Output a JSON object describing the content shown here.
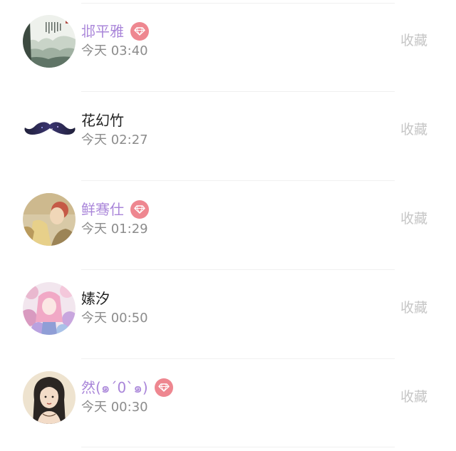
{
  "records": [
    {
      "name": "邶平雅",
      "vip": true,
      "time": "今天 03:40",
      "action": "收藏",
      "avatar_icon": "landscape-painting-avatar-icon"
    },
    {
      "name": "花幻竹",
      "vip": false,
      "time": "今天 02:27",
      "action": "收藏",
      "avatar_icon": "mustache-avatar-icon"
    },
    {
      "name": "鲜骞仕",
      "vip": true,
      "time": "今天 01:29",
      "action": "收藏",
      "avatar_icon": "portrait-photo-avatar-icon"
    },
    {
      "name": "嫊汐",
      "vip": false,
      "time": "今天 00:50",
      "action": "收藏",
      "avatar_icon": "flower-girl-avatar-icon"
    },
    {
      "name": "然(๑´0`๑)",
      "vip": true,
      "time": "今天 00:30",
      "action": "收藏",
      "avatar_icon": "illustrated-woman-avatar-icon"
    }
  ],
  "colors": {
    "vip_name": "#a985d9",
    "vip_badge": "#ee8790",
    "name": "#202020",
    "time": "#8c8c8c",
    "action": "#c6c6c6",
    "separator": "#f0f0f0"
  },
  "badge_icon": "diamond-icon"
}
